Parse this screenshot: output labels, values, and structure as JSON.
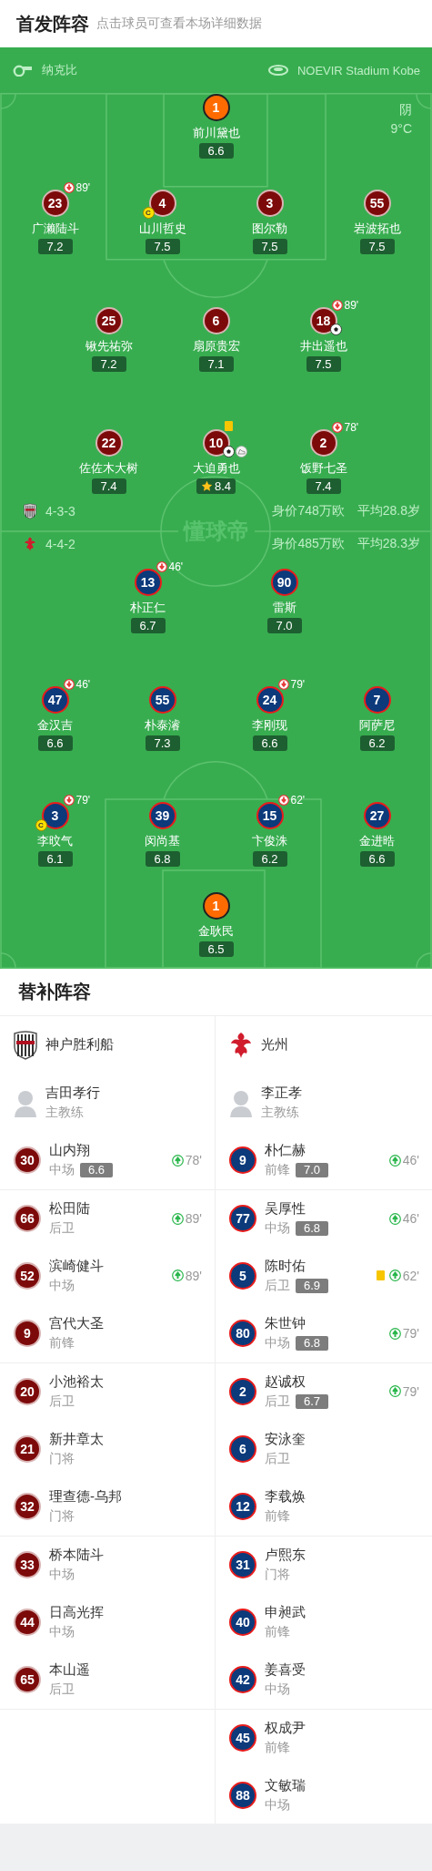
{
  "header": {
    "title": "首发阵容",
    "subtitle": "点击球员可查看本场详细数据"
  },
  "match": {
    "referee": "纳克比",
    "stadium": "NOEVIR Stadium Kobe",
    "weather": "阴",
    "temperature": "9°C",
    "pitch_logo": "懂球帝"
  },
  "home": {
    "formation": "4-3-3",
    "value": "身价748万欧",
    "average_age": "平均28.8岁",
    "lines": [
      [
        {
          "number": "1",
          "name": "前川黛也",
          "rating": "6.6",
          "kind": "keeper"
        }
      ],
      [
        {
          "number": "23",
          "name": "广濑陆斗",
          "rating": "7.2",
          "kind": "outfield",
          "sub_off": "89'"
        },
        {
          "number": "4",
          "name": "山川哲史",
          "rating": "7.5",
          "kind": "outfield",
          "captain_badge": "C"
        },
        {
          "number": "3",
          "name": "图尔勒",
          "rating": "7.5",
          "kind": "outfield"
        },
        {
          "number": "55",
          "name": "岩波拓也",
          "rating": "7.5",
          "kind": "outfield"
        }
      ],
      [
        {
          "number": "25",
          "name": "锹先祐弥",
          "rating": "7.2",
          "kind": "outfield"
        },
        {
          "number": "6",
          "name": "扇原贵宏",
          "rating": "7.1",
          "kind": "outfield"
        },
        {
          "number": "18",
          "name": "井出遥也",
          "rating": "7.5",
          "kind": "outfield",
          "sub_off": "89'",
          "goal": true
        }
      ],
      [
        {
          "number": "22",
          "name": "佐佐木大树",
          "rating": "7.4",
          "kind": "outfield"
        },
        {
          "number": "10",
          "name": "大迫勇也",
          "rating": "8.4",
          "kind": "outfield",
          "yellow_card": true,
          "goal": true,
          "assist": true,
          "top_rated": true
        },
        {
          "number": "2",
          "name": "饭野七圣",
          "rating": "7.4",
          "kind": "outfield",
          "sub_off": "78'"
        }
      ]
    ]
  },
  "away": {
    "formation": "4-4-2",
    "value": "身价485万欧",
    "average_age": "平均28.3岁",
    "lines": [
      [
        {
          "number": "13",
          "name": "朴正仁",
          "rating": "6.7",
          "kind": "outfield",
          "sub_off": "46'"
        },
        {
          "number": "90",
          "name": "雷斯",
          "rating": "7.0",
          "kind": "outfield"
        }
      ],
      [
        {
          "number": "47",
          "name": "金汉吉",
          "rating": "6.6",
          "kind": "outfield",
          "sub_off": "46'"
        },
        {
          "number": "55",
          "name": "朴泰濬",
          "rating": "7.3",
          "kind": "outfield"
        },
        {
          "number": "24",
          "name": "李刚现",
          "rating": "6.6",
          "kind": "outfield",
          "sub_off": "79'"
        },
        {
          "number": "7",
          "name": "阿萨尼",
          "rating": "6.2",
          "kind": "outfield"
        }
      ],
      [
        {
          "number": "3",
          "name": "李旼气",
          "rating": "6.1",
          "kind": "outfield",
          "sub_off": "79'",
          "captain_badge": "C"
        },
        {
          "number": "39",
          "name": "闵尚基",
          "rating": "6.8",
          "kind": "outfield"
        },
        {
          "number": "15",
          "name": "卞俊洙",
          "rating": "6.2",
          "kind": "outfield",
          "sub_off": "62'"
        },
        {
          "number": "27",
          "name": "金进晧",
          "rating": "6.6",
          "kind": "outfield"
        }
      ],
      [
        {
          "number": "1",
          "name": "金耿民",
          "rating": "6.5",
          "kind": "keeper"
        }
      ]
    ]
  },
  "subs": {
    "title": "替补阵容",
    "home_team": "神户胜利船",
    "away_team": "光州",
    "home_coach": {
      "name": "吉田孝行",
      "role": "主教练"
    },
    "away_coach": {
      "name": "李正孝",
      "role": "主教练"
    },
    "groups": [
      [
        {
          "home": {
            "number": "30",
            "name": "山内翔",
            "position": "中场",
            "rating": "6.6",
            "sub_on": "78'"
          },
          "away": {
            "number": "9",
            "name": "朴仁赫",
            "position": "前锋",
            "rating": "7.0",
            "sub_on": "46'"
          }
        }
      ],
      [
        {
          "home": {
            "number": "66",
            "name": "松田陆",
            "position": "后卫",
            "sub_on": "89'"
          },
          "away": {
            "number": "77",
            "name": "吴厚性",
            "position": "中场",
            "rating": "6.8",
            "sub_on": "46'"
          }
        },
        {
          "home": {
            "number": "52",
            "name": "滨崎健斗",
            "position": "中场",
            "sub_on": "89'"
          },
          "away": {
            "number": "5",
            "name": "陈时佑",
            "position": "后卫",
            "rating": "6.9",
            "sub_on": "62'",
            "yellow_card": true
          }
        },
        {
          "home": {
            "number": "9",
            "name": "宫代大圣",
            "position": "前锋"
          },
          "away": {
            "number": "80",
            "name": "朱世钟",
            "position": "中场",
            "rating": "6.8",
            "sub_on": "79'"
          }
        }
      ],
      [
        {
          "home": {
            "number": "20",
            "name": "小池裕太",
            "position": "后卫"
          },
          "away": {
            "number": "2",
            "name": "赵诚权",
            "position": "后卫",
            "rating": "6.7",
            "sub_on": "79'"
          }
        },
        {
          "home": {
            "number": "21",
            "name": "新井章太",
            "position": "门将"
          },
          "away": {
            "number": "6",
            "name": "安泳奎",
            "position": "后卫"
          }
        },
        {
          "home": {
            "number": "32",
            "name": "理查德-乌邦",
            "position": "门将"
          },
          "away": {
            "number": "12",
            "name": "李载焕",
            "position": "前锋"
          }
        }
      ],
      [
        {
          "home": {
            "number": "33",
            "name": "桥本陆斗",
            "position": "中场"
          },
          "away": {
            "number": "31",
            "name": "卢熙东",
            "position": "门将"
          }
        },
        {
          "home": {
            "number": "44",
            "name": "日高光挥",
            "position": "中场"
          },
          "away": {
            "number": "40",
            "name": "申昶武",
            "position": "前锋"
          }
        },
        {
          "home": {
            "number": "65",
            "name": "本山遥",
            "position": "后卫"
          },
          "away": {
            "number": "42",
            "name": "姜喜受",
            "position": "中场"
          }
        }
      ],
      [
        {
          "away": {
            "number": "45",
            "name": "权成尹",
            "position": "前锋"
          }
        },
        {
          "away": {
            "number": "88",
            "name": "文敏瑞",
            "position": "中场"
          }
        }
      ]
    ]
  }
}
